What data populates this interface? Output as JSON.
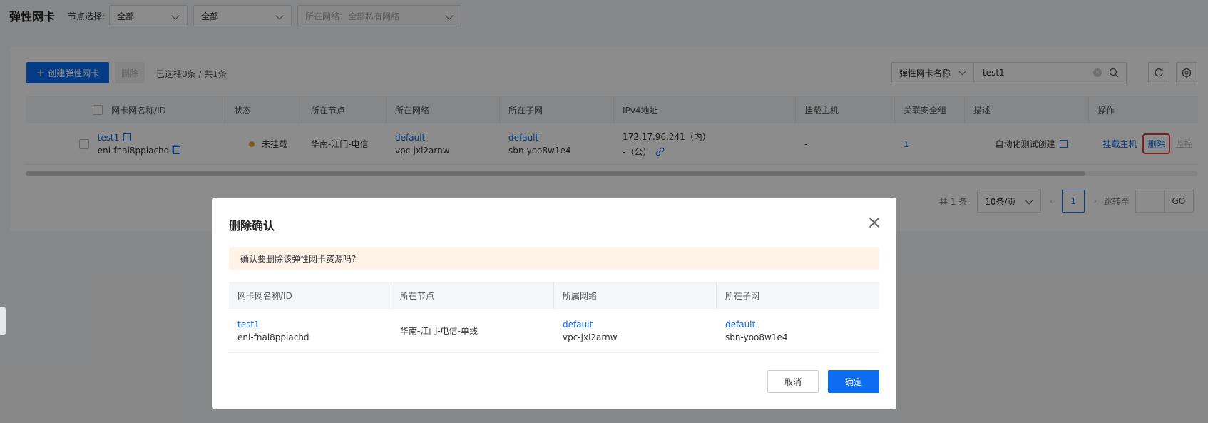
{
  "header": {
    "title": "弹性网卡",
    "node_label": "节点选择:",
    "node_select_value": "全部",
    "second_select_value": "全部",
    "network_select_placeholder": "所在网络：全部私有网络"
  },
  "toolbar": {
    "create_label": "创建弹性网卡",
    "delete_label": "删除",
    "selection_text": "已选择0条 / 共1条",
    "search_type": "弹性网卡名称",
    "search_value": "test1"
  },
  "table": {
    "columns": [
      "网卡网名称/ID",
      "状态",
      "所在节点",
      "所在网络",
      "所在子网",
      "IPv4地址",
      "挂载主机",
      "关联安全组",
      "描述",
      "操作"
    ],
    "rows": [
      {
        "name": "test1",
        "id": "eni-fnal8ppiachd",
        "status": "未挂载",
        "node": "华南-江门-电信",
        "network": "default",
        "vpc": "vpc-jxl2arnw",
        "subnet": "default",
        "subnet_id": "sbn-yoo8w1e4",
        "ipv4_inner": "172.17.96.241（内）",
        "ipv4_public": "-（公）",
        "host": "-",
        "security_groups": "1",
        "description": "自动化测试创建",
        "action_mount": "挂载主机",
        "action_delete": "删除",
        "action_monitor": "监控"
      }
    ]
  },
  "pager": {
    "total": "共 1 条",
    "page_size": "10条/页",
    "current_page": "1",
    "jump_label": "跳转至",
    "go_label": "GO"
  },
  "modal": {
    "title": "删除确认",
    "alert": "确认要删除该弹性网卡资源吗?",
    "columns": [
      "网卡网名称/ID",
      "所在节点",
      "所属网络",
      "所在子网"
    ],
    "row": {
      "name": "test1",
      "id": "eni-fnal8ppiachd",
      "node": "华南-江门-电信-单线",
      "network": "default",
      "vpc": "vpc-jxl2arnw",
      "subnet": "default",
      "subnet_id": "sbn-yoo8w1e4"
    },
    "cancel_label": "取消",
    "ok_label": "确定"
  },
  "colors": {
    "primary": "#0c6cf2",
    "status_unmounted": "#e8a23a",
    "alert_bg": "#fff3e8",
    "highlight": "#e53935"
  }
}
